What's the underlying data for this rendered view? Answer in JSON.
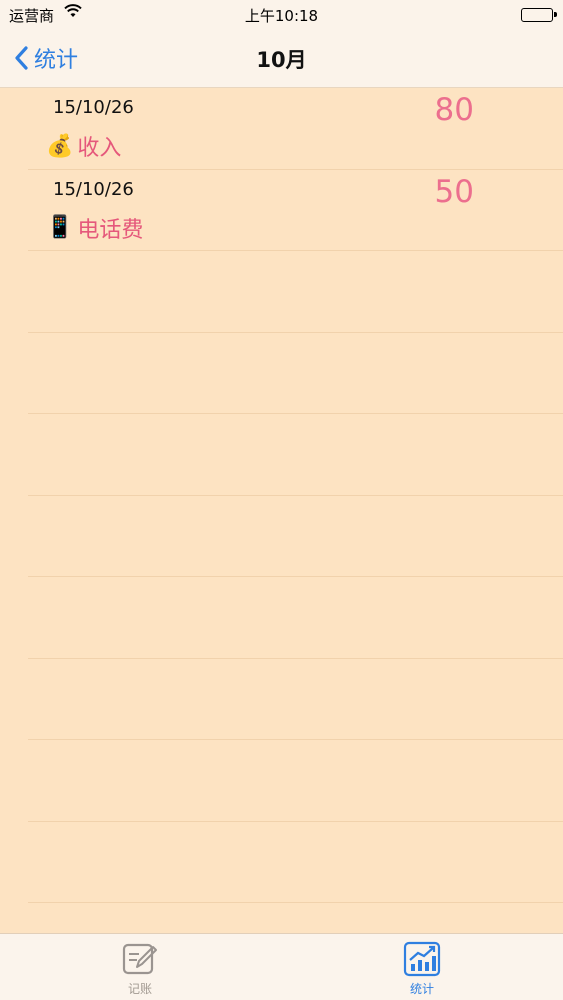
{
  "status_bar": {
    "carrier": "运营商",
    "time": "上午10:18"
  },
  "nav": {
    "back_label": "统计",
    "title": "10月"
  },
  "entries": [
    {
      "date": "15/10/26",
      "icon": "money-bag-icon",
      "emoji": "💰",
      "category": "收入",
      "amount": "80"
    },
    {
      "date": "15/10/26",
      "icon": "mobile-phone-icon",
      "emoji": "📱",
      "category": "电话费",
      "amount": "50"
    }
  ],
  "tabs": [
    {
      "label": "记账",
      "icon": "edit-icon",
      "active": false
    },
    {
      "label": "统计",
      "icon": "chart-icon",
      "active": true
    }
  ],
  "colors": {
    "background": "#fde3c2",
    "accent": "#2f7fe0",
    "category_text": "#e5587b",
    "amount_text": "#ec6f8e"
  }
}
